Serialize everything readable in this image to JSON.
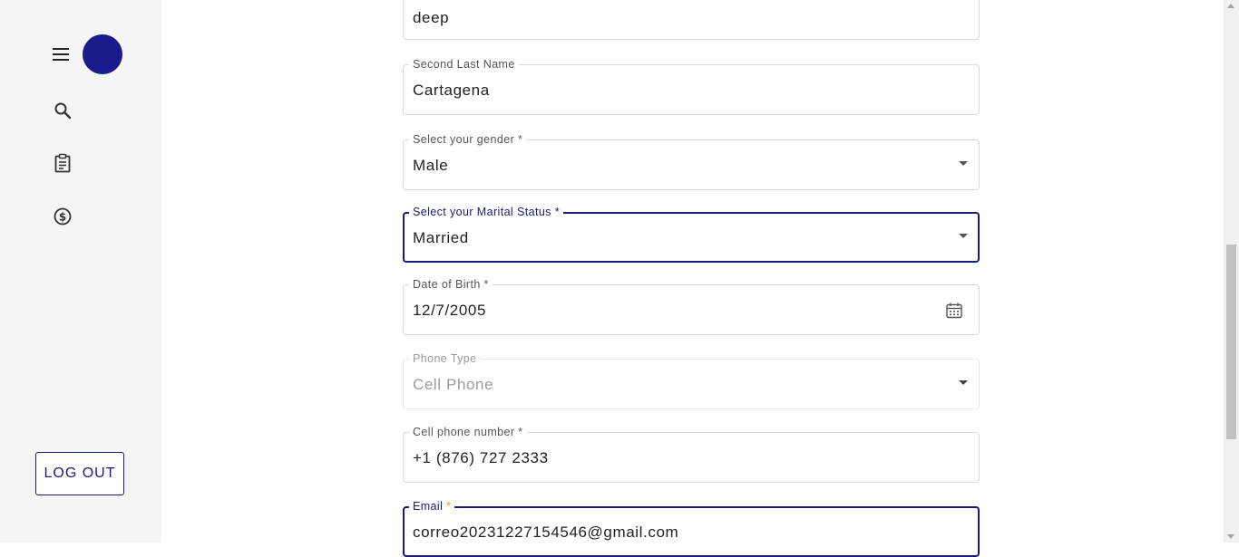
{
  "sidebar": {
    "menu_icon": "hamburger-menu-icon",
    "avatar_color": "#1a1a8c",
    "nav_items": [
      {
        "icon": "search-icon"
      },
      {
        "icon": "clipboard-icon"
      },
      {
        "icon": "dollar-icon"
      }
    ],
    "logout_label": "LOG OUT"
  },
  "form": {
    "last_name": {
      "value": "deep"
    },
    "second_last_name": {
      "label": "Second Last Name",
      "value": "Cartagena"
    },
    "gender": {
      "label": "Select your gender *",
      "value": "Male"
    },
    "marital_status": {
      "label": "Select your Marital Status *",
      "value": "Married"
    },
    "date_of_birth": {
      "label": "Date of Birth *",
      "value": "12/7/2005"
    },
    "phone_type": {
      "label": "Phone Type",
      "value": "Cell Phone"
    },
    "cell_phone": {
      "label": "Cell phone number *",
      "value": "+1 (876) 727 2333"
    },
    "email": {
      "label": "Email",
      "required_mark": "*",
      "value": "correo20231227154546@gmail.com"
    }
  },
  "colors": {
    "accent": "#1a1a7a",
    "required_asterisk": "#e6a000",
    "sidebar_bg": "#f5f5f5"
  }
}
